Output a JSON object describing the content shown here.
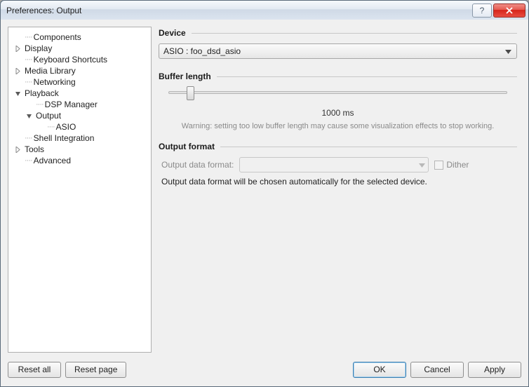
{
  "window": {
    "title": "Preferences: Output"
  },
  "tree": {
    "items": [
      {
        "label": "Components",
        "depth": 0,
        "expander": "none"
      },
      {
        "label": "Display",
        "depth": 0,
        "expander": "closed"
      },
      {
        "label": "Keyboard Shortcuts",
        "depth": 0,
        "expander": "none"
      },
      {
        "label": "Media Library",
        "depth": 0,
        "expander": "closed"
      },
      {
        "label": "Networking",
        "depth": 0,
        "expander": "none"
      },
      {
        "label": "Playback",
        "depth": 0,
        "expander": "open"
      },
      {
        "label": "DSP Manager",
        "depth": 1,
        "expander": "none"
      },
      {
        "label": "Output",
        "depth": 1,
        "expander": "open"
      },
      {
        "label": "ASIO",
        "depth": 2,
        "expander": "none"
      },
      {
        "label": "Shell Integration",
        "depth": 0,
        "expander": "none"
      },
      {
        "label": "Tools",
        "depth": 0,
        "expander": "closed"
      },
      {
        "label": "Advanced",
        "depth": 0,
        "expander": "none"
      }
    ]
  },
  "panel": {
    "device": {
      "title": "Device",
      "selected": "ASIO : foo_dsd_asio"
    },
    "buffer": {
      "title": "Buffer length",
      "value_label": "1000 ms",
      "warning": "Warning: setting too low buffer length may cause some visualization effects to stop working."
    },
    "format": {
      "title": "Output format",
      "field_label": "Output data format:",
      "dither_label": "Dither",
      "note": "Output data format will be chosen automatically for the selected device."
    }
  },
  "buttons": {
    "reset_all": "Reset all",
    "reset_page": "Reset page",
    "ok": "OK",
    "cancel": "Cancel",
    "apply": "Apply"
  }
}
